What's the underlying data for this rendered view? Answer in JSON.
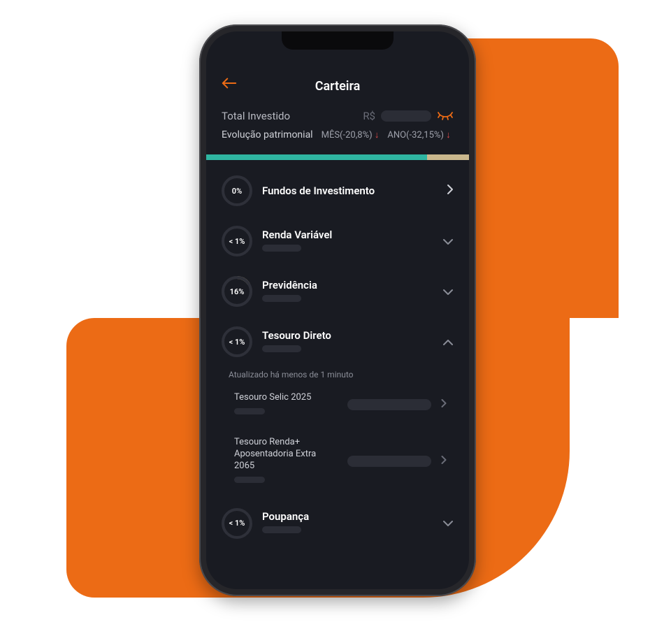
{
  "header": {
    "title": "Carteira"
  },
  "summary": {
    "total_label": "Total Investido",
    "currency_prefix": "R$",
    "evolution_label": "Evolução patrimonial",
    "month_stat": "MÊS(-20,8%)",
    "year_stat": "ANO(-32,15%)",
    "down_glyph": "↓"
  },
  "allocation_bar": [
    {
      "color": "teal",
      "pct": 84
    },
    {
      "color": "tan",
      "pct": 16
    }
  ],
  "categories": [
    {
      "pct_label": "0%",
      "title": "Fundos de Investimento",
      "chevron": "right",
      "ring_pct": 0
    },
    {
      "pct_label": "< 1%",
      "title": "Renda Variável",
      "chevron": "down",
      "ring_pct": 0
    },
    {
      "pct_label": "16%",
      "title": "Previdência",
      "chevron": "down",
      "ring_pct": 16
    },
    {
      "pct_label": "< 1%",
      "title": "Tesouro Direto",
      "chevron": "up",
      "ring_pct": 0,
      "expanded": true
    },
    {
      "pct_label": "< 1%",
      "title": "Poupança",
      "chevron": "down",
      "ring_pct": 0
    }
  ],
  "expanded": {
    "update_note": "Atualizado há menos de 1 minuto",
    "items": [
      {
        "title": "Tesouro Selic 2025"
      },
      {
        "title": "Tesouro Renda+ Aposentadoria Extra 2065"
      }
    ]
  }
}
